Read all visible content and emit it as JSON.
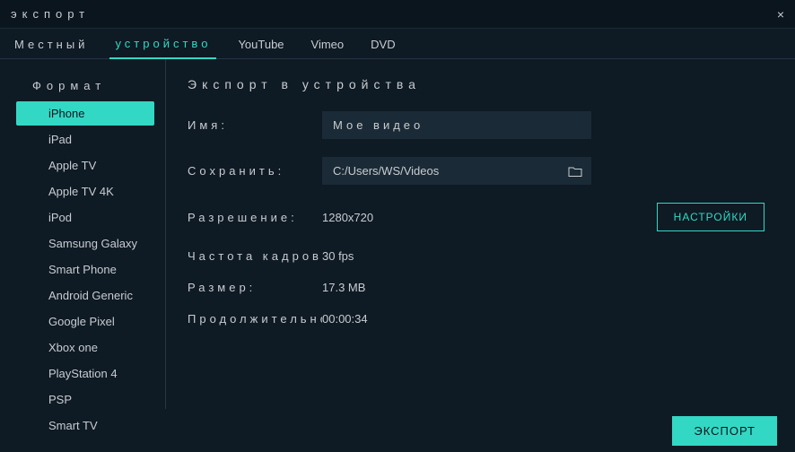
{
  "window": {
    "title": "экспорт",
    "close": "×"
  },
  "tabs": {
    "local": "Местный",
    "device": "устройство",
    "youtube": "YouTube",
    "vimeo": "Vimeo",
    "dvd": "DVD"
  },
  "sidebar": {
    "header": "Формат",
    "items": [
      "iPhone",
      "iPad",
      "Apple TV",
      "Apple TV 4K",
      "iPod",
      "Samsung Galaxy",
      "Smart Phone",
      "Android Generic",
      "Google Pixel",
      "Xbox one",
      "PlayStation 4",
      "PSP",
      "Smart TV"
    ]
  },
  "main": {
    "title": "Экспорт в устройства",
    "name_label": "Имя:",
    "name_value": "Мое видео",
    "save_label": "Сохранить:",
    "save_value": "C:/Users/WS/Videos",
    "resolution_label": "Разрешение:",
    "resolution_value": "1280x720",
    "settings_btn": "НАСТРОЙКИ",
    "framerate_label": "Частота кадров:",
    "framerate_value": "30 fps",
    "size_label": "Размер:",
    "size_value": "17.3 MB",
    "duration_label": "Продолжительность:",
    "duration_value": "00:00:34"
  },
  "footer": {
    "export_btn": "ЭКСПОРТ"
  }
}
